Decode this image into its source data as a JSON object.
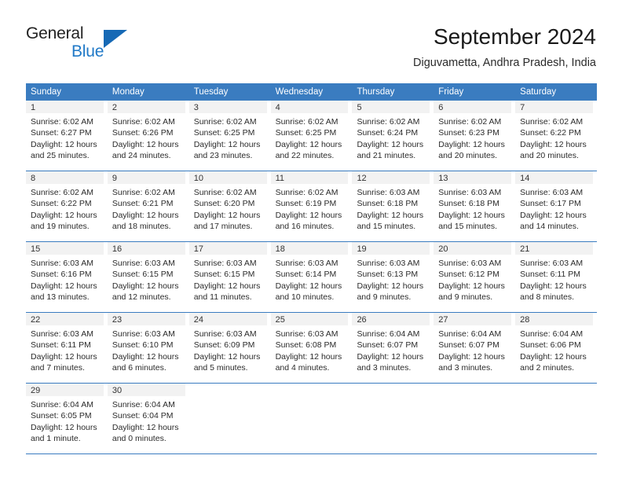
{
  "brand": {
    "name_line1": "General",
    "name_line2": "Blue",
    "triangle_icon": "triangle-icon",
    "color_text": "#222222",
    "color_blue": "#2079c7"
  },
  "header": {
    "title": "September 2024",
    "subtitle": "Diguvametta, Andhra Pradesh, India"
  },
  "theme": {
    "header_blue": "#3a7cc0",
    "day_band_gray": "#f2f2f2",
    "text": "#2b2b2b"
  },
  "weekday_headers": [
    "Sunday",
    "Monday",
    "Tuesday",
    "Wednesday",
    "Thursday",
    "Friday",
    "Saturday"
  ],
  "weeks": [
    [
      {
        "day": "1",
        "sunrise": "Sunrise: 6:02 AM",
        "sunset": "Sunset: 6:27 PM",
        "daylight1": "Daylight: 12 hours",
        "daylight2": "and 25 minutes."
      },
      {
        "day": "2",
        "sunrise": "Sunrise: 6:02 AM",
        "sunset": "Sunset: 6:26 PM",
        "daylight1": "Daylight: 12 hours",
        "daylight2": "and 24 minutes."
      },
      {
        "day": "3",
        "sunrise": "Sunrise: 6:02 AM",
        "sunset": "Sunset: 6:25 PM",
        "daylight1": "Daylight: 12 hours",
        "daylight2": "and 23 minutes."
      },
      {
        "day": "4",
        "sunrise": "Sunrise: 6:02 AM",
        "sunset": "Sunset: 6:25 PM",
        "daylight1": "Daylight: 12 hours",
        "daylight2": "and 22 minutes."
      },
      {
        "day": "5",
        "sunrise": "Sunrise: 6:02 AM",
        "sunset": "Sunset: 6:24 PM",
        "daylight1": "Daylight: 12 hours",
        "daylight2": "and 21 minutes."
      },
      {
        "day": "6",
        "sunrise": "Sunrise: 6:02 AM",
        "sunset": "Sunset: 6:23 PM",
        "daylight1": "Daylight: 12 hours",
        "daylight2": "and 20 minutes."
      },
      {
        "day": "7",
        "sunrise": "Sunrise: 6:02 AM",
        "sunset": "Sunset: 6:22 PM",
        "daylight1": "Daylight: 12 hours",
        "daylight2": "and 20 minutes."
      }
    ],
    [
      {
        "day": "8",
        "sunrise": "Sunrise: 6:02 AM",
        "sunset": "Sunset: 6:22 PM",
        "daylight1": "Daylight: 12 hours",
        "daylight2": "and 19 minutes."
      },
      {
        "day": "9",
        "sunrise": "Sunrise: 6:02 AM",
        "sunset": "Sunset: 6:21 PM",
        "daylight1": "Daylight: 12 hours",
        "daylight2": "and 18 minutes."
      },
      {
        "day": "10",
        "sunrise": "Sunrise: 6:02 AM",
        "sunset": "Sunset: 6:20 PM",
        "daylight1": "Daylight: 12 hours",
        "daylight2": "and 17 minutes."
      },
      {
        "day": "11",
        "sunrise": "Sunrise: 6:02 AM",
        "sunset": "Sunset: 6:19 PM",
        "daylight1": "Daylight: 12 hours",
        "daylight2": "and 16 minutes."
      },
      {
        "day": "12",
        "sunrise": "Sunrise: 6:03 AM",
        "sunset": "Sunset: 6:18 PM",
        "daylight1": "Daylight: 12 hours",
        "daylight2": "and 15 minutes."
      },
      {
        "day": "13",
        "sunrise": "Sunrise: 6:03 AM",
        "sunset": "Sunset: 6:18 PM",
        "daylight1": "Daylight: 12 hours",
        "daylight2": "and 15 minutes."
      },
      {
        "day": "14",
        "sunrise": "Sunrise: 6:03 AM",
        "sunset": "Sunset: 6:17 PM",
        "daylight1": "Daylight: 12 hours",
        "daylight2": "and 14 minutes."
      }
    ],
    [
      {
        "day": "15",
        "sunrise": "Sunrise: 6:03 AM",
        "sunset": "Sunset: 6:16 PM",
        "daylight1": "Daylight: 12 hours",
        "daylight2": "and 13 minutes."
      },
      {
        "day": "16",
        "sunrise": "Sunrise: 6:03 AM",
        "sunset": "Sunset: 6:15 PM",
        "daylight1": "Daylight: 12 hours",
        "daylight2": "and 12 minutes."
      },
      {
        "day": "17",
        "sunrise": "Sunrise: 6:03 AM",
        "sunset": "Sunset: 6:15 PM",
        "daylight1": "Daylight: 12 hours",
        "daylight2": "and 11 minutes."
      },
      {
        "day": "18",
        "sunrise": "Sunrise: 6:03 AM",
        "sunset": "Sunset: 6:14 PM",
        "daylight1": "Daylight: 12 hours",
        "daylight2": "and 10 minutes."
      },
      {
        "day": "19",
        "sunrise": "Sunrise: 6:03 AM",
        "sunset": "Sunset: 6:13 PM",
        "daylight1": "Daylight: 12 hours",
        "daylight2": "and 9 minutes."
      },
      {
        "day": "20",
        "sunrise": "Sunrise: 6:03 AM",
        "sunset": "Sunset: 6:12 PM",
        "daylight1": "Daylight: 12 hours",
        "daylight2": "and 9 minutes."
      },
      {
        "day": "21",
        "sunrise": "Sunrise: 6:03 AM",
        "sunset": "Sunset: 6:11 PM",
        "daylight1": "Daylight: 12 hours",
        "daylight2": "and 8 minutes."
      }
    ],
    [
      {
        "day": "22",
        "sunrise": "Sunrise: 6:03 AM",
        "sunset": "Sunset: 6:11 PM",
        "daylight1": "Daylight: 12 hours",
        "daylight2": "and 7 minutes."
      },
      {
        "day": "23",
        "sunrise": "Sunrise: 6:03 AM",
        "sunset": "Sunset: 6:10 PM",
        "daylight1": "Daylight: 12 hours",
        "daylight2": "and 6 minutes."
      },
      {
        "day": "24",
        "sunrise": "Sunrise: 6:03 AM",
        "sunset": "Sunset: 6:09 PM",
        "daylight1": "Daylight: 12 hours",
        "daylight2": "and 5 minutes."
      },
      {
        "day": "25",
        "sunrise": "Sunrise: 6:03 AM",
        "sunset": "Sunset: 6:08 PM",
        "daylight1": "Daylight: 12 hours",
        "daylight2": "and 4 minutes."
      },
      {
        "day": "26",
        "sunrise": "Sunrise: 6:04 AM",
        "sunset": "Sunset: 6:07 PM",
        "daylight1": "Daylight: 12 hours",
        "daylight2": "and 3 minutes."
      },
      {
        "day": "27",
        "sunrise": "Sunrise: 6:04 AM",
        "sunset": "Sunset: 6:07 PM",
        "daylight1": "Daylight: 12 hours",
        "daylight2": "and 3 minutes."
      },
      {
        "day": "28",
        "sunrise": "Sunrise: 6:04 AM",
        "sunset": "Sunset: 6:06 PM",
        "daylight1": "Daylight: 12 hours",
        "daylight2": "and 2 minutes."
      }
    ],
    [
      {
        "day": "29",
        "sunrise": "Sunrise: 6:04 AM",
        "sunset": "Sunset: 6:05 PM",
        "daylight1": "Daylight: 12 hours",
        "daylight2": "and 1 minute."
      },
      {
        "day": "30",
        "sunrise": "Sunrise: 6:04 AM",
        "sunset": "Sunset: 6:04 PM",
        "daylight1": "Daylight: 12 hours",
        "daylight2": "and 0 minutes."
      },
      {
        "day": "",
        "sunrise": "",
        "sunset": "",
        "daylight1": "",
        "daylight2": ""
      },
      {
        "day": "",
        "sunrise": "",
        "sunset": "",
        "daylight1": "",
        "daylight2": ""
      },
      {
        "day": "",
        "sunrise": "",
        "sunset": "",
        "daylight1": "",
        "daylight2": ""
      },
      {
        "day": "",
        "sunrise": "",
        "sunset": "",
        "daylight1": "",
        "daylight2": ""
      },
      {
        "day": "",
        "sunrise": "",
        "sunset": "",
        "daylight1": "",
        "daylight2": ""
      }
    ]
  ]
}
